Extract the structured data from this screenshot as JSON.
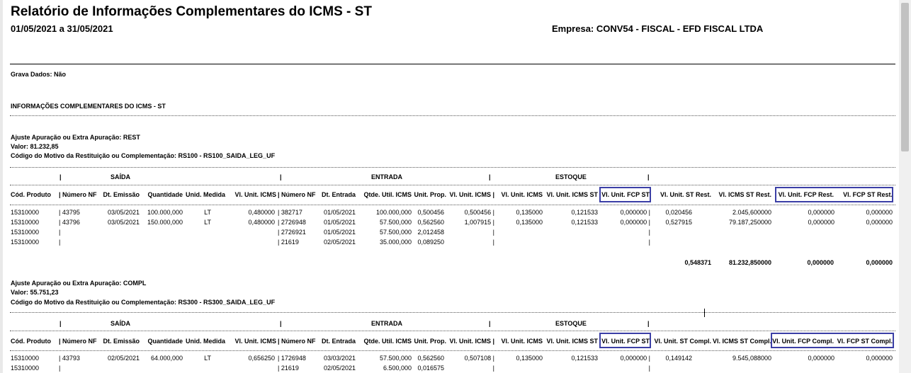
{
  "report": {
    "title": "Relatório de Informações Complementares do ICMS - ST",
    "period": "01/05/2021 a 31/05/2021",
    "empresa": "Empresa: CONV54 - FISCAL - EFD FISCAL LTDA",
    "grava_dados": "Grava Dados: Não",
    "section_title": "INFORMAÇÕES COMPLEMENTARES DO ICMS - ST"
  },
  "group_headers": {
    "saida": "SAÍDA",
    "entrada": "ENTRADA",
    "estoque": "ESTOQUE"
  },
  "block1": {
    "ajuste": "Ajuste Apuração ou Extra Apuração: REST",
    "valor": "Valor: 81.232,85",
    "codigo": "Código do Motivo da Restituição ou Complementação: RS100 - RS100_SAIDA_LEG_UF",
    "columns": [
      "Cód. Produto",
      "| Número NF",
      "Dt. Emissão",
      "Quantidade",
      "Unid. Medida",
      "Vl. Unit. ICMS",
      "| Número NF",
      "Dt. Entrada",
      "Qtde. Util. ICMS",
      "Unit. Prop.",
      "Vl. Unit. ICMS |",
      "Vl. Unit. ICMS",
      "Vl. Unit. ICMS ST",
      "Vl. Unit. FCP ST",
      "Vl. Unit. ST Rest.",
      "Vl. ICMS ST Rest.",
      "Vl. Unit. FCP Rest.",
      "Vl. FCP ST Rest."
    ],
    "rows": [
      [
        "15310000",
        "| 43795",
        "03/05/2021",
        "100.000,000",
        "LT",
        "0,480000",
        "| 382717",
        "01/05/2021",
        "100.000,000",
        "0,500456",
        "0,500456 |",
        "0,135000",
        "0,121533",
        "0,000000 |",
        "0,020456",
        "2.045,600000",
        "0,000000",
        "0,000000"
      ],
      [
        "15310000",
        "| 43796",
        "03/05/2021",
        "150.000,000",
        "LT",
        "0,480000",
        "| 2726948",
        "01/05/2021",
        "57.500,000",
        "0,562560",
        "1,007915 |",
        "0,135000",
        "0,121533",
        "0,000000 |",
        "0,527915",
        "79.187,250000",
        "0,000000",
        "0,000000"
      ],
      [
        "15310000",
        "|",
        "",
        "",
        "",
        "",
        "| 2726921",
        "01/05/2021",
        "57.500,000",
        "2,012458",
        "|",
        "",
        "",
        "|",
        "",
        "",
        "",
        ""
      ],
      [
        "15310000",
        "|",
        "",
        "",
        "",
        "",
        "| 21619",
        "02/05/2021",
        "35.000,000",
        "0,089250",
        "|",
        "",
        "",
        "|",
        "",
        "",
        "",
        ""
      ]
    ],
    "totals": [
      "0,548371",
      "81.232,850000",
      "0,000000",
      "0,000000"
    ]
  },
  "block2": {
    "ajuste": "Ajuste Apuração ou Extra Apuração: COMPL",
    "valor": "Valor: 55.751,23",
    "codigo": "Código do Motivo da Restituição ou Complementação: RS300 - RS300_SAIDA_LEG_UF",
    "columns": [
      "Cód. Produto",
      "| Número NF",
      "Dt. Emissão",
      "Quantidade",
      "Unid. Medida",
      "Vl. Unit. ICMS",
      "| Número NF",
      "Dt. Entrada",
      "Qtde. Util. ICMS",
      "Unit. Prop.",
      "Vl. Unit. ICMS |",
      "Vl. Unit. ICMS",
      "Vl. Unit. ICMS ST",
      "Vl. Unit. FCP ST",
      "Vl. Unit. ST Compl.",
      "Vl. ICMS ST Compl.",
      "Vl. Unit. FCP Compl.",
      "Vl. FCP ST Compl."
    ],
    "rows": [
      [
        "15310000",
        "| 43793",
        "02/05/2021",
        "64.000,000",
        "LT",
        "0,656250",
        "| 1726948",
        "03/03/2021",
        "57.500,000",
        "0,562560",
        "0,507108 |",
        "0,135000",
        "0,121533",
        "0,000000 |",
        "0,149142",
        "9.545,088000",
        "0,000000",
        "0,000000"
      ],
      [
        "15310000",
        "|",
        "",
        "",
        "",
        "",
        "| 21619",
        "02/05/2021",
        "6.500,000",
        "0,016575",
        "|",
        "",
        "",
        "|",
        "",
        "",
        "",
        ""
      ]
    ]
  }
}
